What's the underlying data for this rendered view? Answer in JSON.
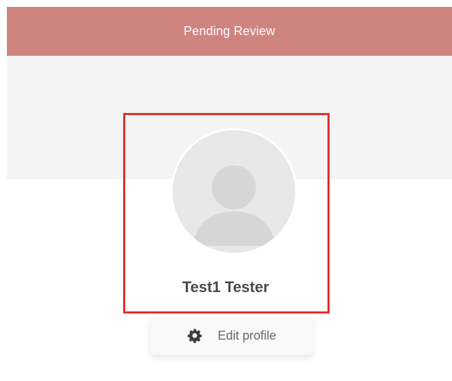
{
  "status_banner": {
    "text": "Pending Review",
    "color": "#cf8480"
  },
  "profile": {
    "name": "Test1 Tester",
    "avatar_icon": "user-placeholder-icon"
  },
  "actions": {
    "edit_profile_label": "Edit profile",
    "edit_profile_icon": "gear-icon"
  },
  "highlight": {
    "color": "#e52b2b"
  }
}
